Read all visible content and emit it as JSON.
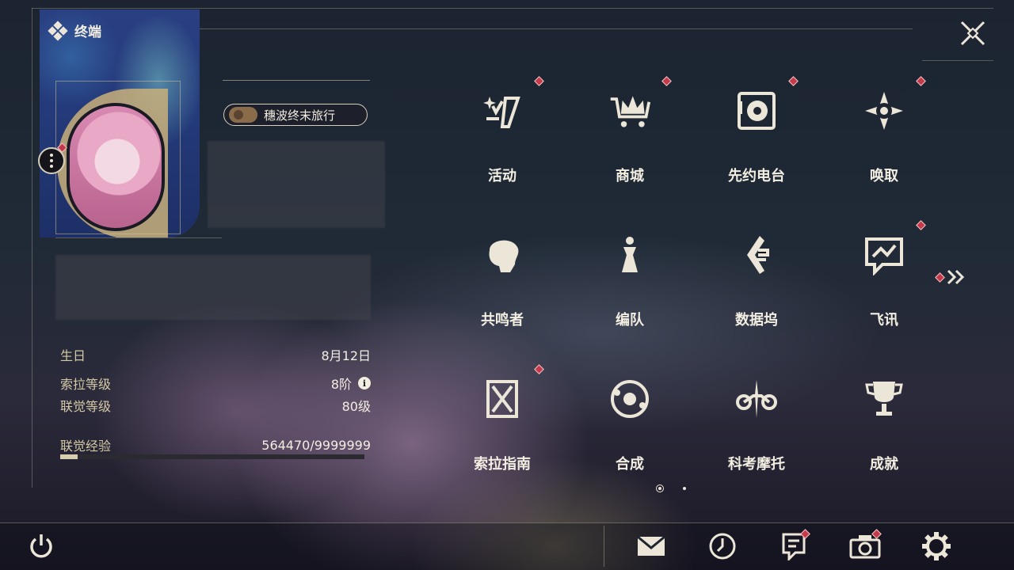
{
  "header": {
    "title": "终端"
  },
  "profile": {
    "title_badge": "穗波终末旅行",
    "stats": [
      {
        "label": "生日",
        "value": "8月12日"
      },
      {
        "label": "索拉等级",
        "value": "8阶"
      },
      {
        "label": "联觉等级",
        "value": "80级"
      }
    ],
    "exp": {
      "label": "联觉经验",
      "value": "564470/9999999",
      "fraction": 0.0564
    },
    "info_glyph": "i"
  },
  "menu": [
    {
      "label": "活动",
      "icon": "activity-icon",
      "badge": true
    },
    {
      "label": "商城",
      "icon": "shop-crown-cart-icon",
      "badge": true
    },
    {
      "label": "先约电台",
      "icon": "radio-station-icon",
      "badge": true
    },
    {
      "label": "唤取",
      "icon": "summon-compass-icon",
      "badge": true
    },
    {
      "label": "共鸣者",
      "icon": "resonator-head-icon",
      "badge": false
    },
    {
      "label": "编队",
      "icon": "team-chess-icon",
      "badge": false
    },
    {
      "label": "数据坞",
      "icon": "data-dock-icon",
      "badge": false
    },
    {
      "label": "飞讯",
      "icon": "message-chat-icon",
      "badge": true
    },
    {
      "label": "索拉指南",
      "icon": "guide-book-icon",
      "badge": true
    },
    {
      "label": "合成",
      "icon": "synthesis-orbit-icon",
      "badge": false
    },
    {
      "label": "科考摩托",
      "icon": "motorcycle-icon",
      "badge": false
    },
    {
      "label": "成就",
      "icon": "achievement-trophy-icon",
      "badge": false
    }
  ],
  "bottom_bar": [
    {
      "icon": "mail-icon",
      "badge": false
    },
    {
      "icon": "clock-event-icon",
      "badge": false
    },
    {
      "icon": "notice-document-icon",
      "badge": true
    },
    {
      "icon": "camera-icon",
      "badge": true
    },
    {
      "icon": "settings-gear-icon",
      "badge": false
    }
  ],
  "colors": {
    "accent": "#ece6d8",
    "badge_red": "#c43a4a",
    "label_gold": "#d4c9a6"
  }
}
